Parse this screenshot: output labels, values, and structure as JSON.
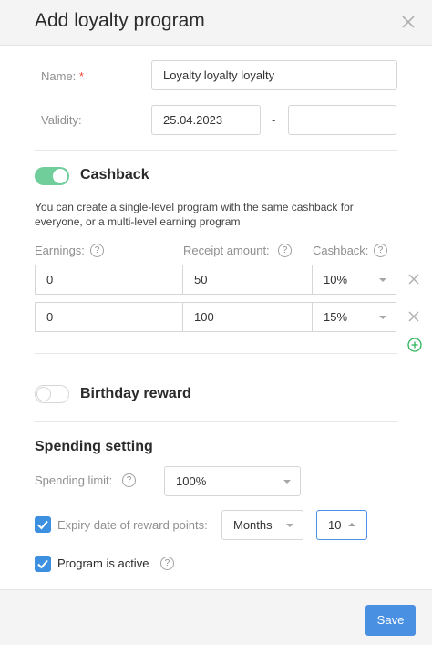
{
  "header": {
    "title": "Add loyalty program"
  },
  "form": {
    "name_label": "Name:",
    "name_required": "*",
    "name_value": "Loyalty loyalty loyalty",
    "validity_label": "Validity:",
    "validity_from": "25.04.2023",
    "validity_separator": "-",
    "validity_to": ""
  },
  "cashback": {
    "title": "Cashback",
    "enabled": true,
    "description": "You can create a single-level program with the same cashback for everyone, or a multi-level earning program",
    "columns": {
      "earnings": "Earnings:",
      "receipt": "Receipt amount:",
      "cashback": "Cashback:"
    },
    "rows": [
      {
        "earnings": "0",
        "receipt": "50",
        "cashback": "10%"
      },
      {
        "earnings": "0",
        "receipt": "100",
        "cashback": "15%"
      }
    ]
  },
  "birthday": {
    "title": "Birthday reward",
    "enabled": false
  },
  "spending": {
    "title": "Spending setting",
    "limit_label": "Spending limit:",
    "limit_value": "100%",
    "expiry_label": "Expiry date of reward points:",
    "expiry_unit": "Months",
    "expiry_value": "10",
    "active_label": "Program is active"
  },
  "help_glyph": "?",
  "footer": {
    "save_label": "Save"
  },
  "colors": {
    "accent": "#4a90e2",
    "toggle_on": "#6fce9a",
    "add": "#2eb35a"
  },
  "icons": [
    "close-icon",
    "help-icon",
    "remove-row-icon",
    "add-row-icon",
    "caret-down-icon",
    "caret-up-icon",
    "check-icon"
  ]
}
